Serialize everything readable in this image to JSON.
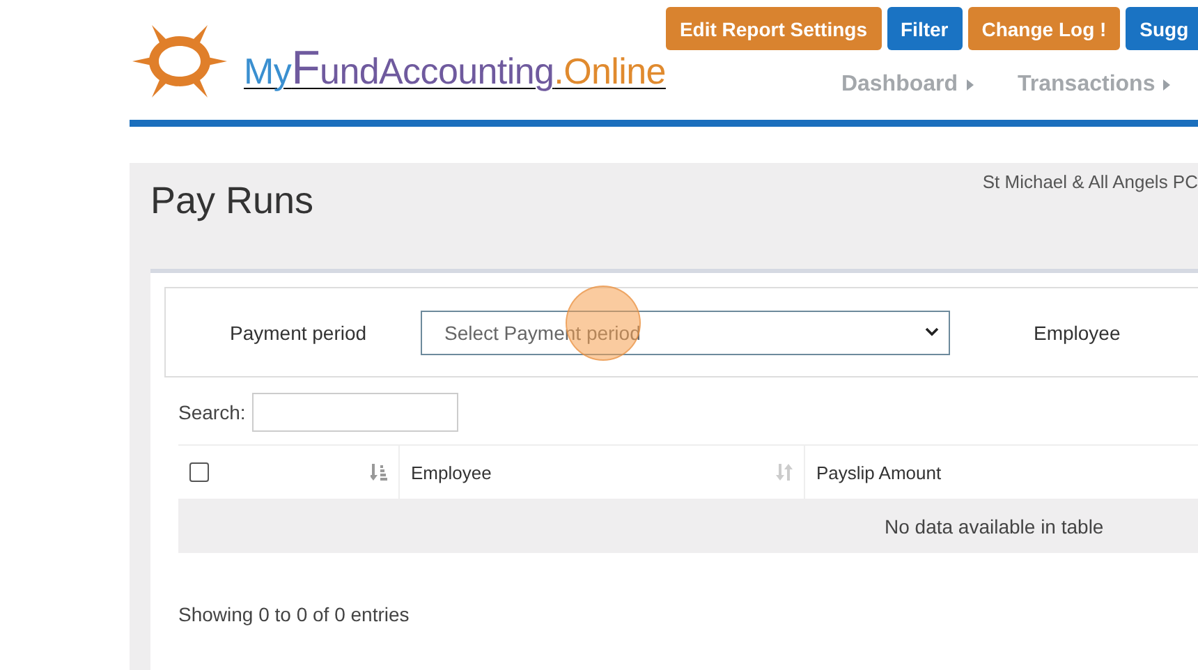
{
  "logo": {
    "parts": [
      {
        "text": "My",
        "color": "#3a8fd0"
      },
      {
        "text": "F",
        "color": "#6f5a9e"
      },
      {
        "text": "undAccounting",
        "color": "#6f5a9e"
      },
      {
        "text": ".Online",
        "color": "#e08a2e"
      }
    ]
  },
  "header_buttons": [
    {
      "label": "Edit Report Settings",
      "kind": "orange"
    },
    {
      "label": "Filter",
      "kind": "blue"
    },
    {
      "label": "Change Log !",
      "kind": "orange"
    },
    {
      "label": "Sugg",
      "kind": "blue"
    }
  ],
  "nav": [
    {
      "label": "Dashboard"
    },
    {
      "label": "Transactions"
    }
  ],
  "page": {
    "title": "Pay Runs",
    "organisation": "St Michael & All Angels PC"
  },
  "filters": {
    "payment_period_label": "Payment period",
    "payment_period_placeholder": "Select Payment period",
    "employee_label": "Employee"
  },
  "search": {
    "label": "Search:"
  },
  "table": {
    "select_all_checked": false,
    "columns": [
      "Employee",
      "Payslip Amount"
    ],
    "empty_message": "No data available in table"
  },
  "info": "Showing 0 to 0 of 0 entries"
}
